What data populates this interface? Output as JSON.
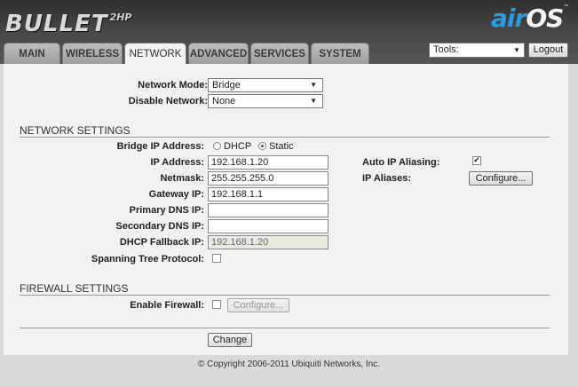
{
  "header": {
    "product_logo": "BULLET",
    "product_model": "2HP",
    "brand_air": "air",
    "brand_os": "OS",
    "brand_tm": "™"
  },
  "tabs": [
    "MAIN",
    "WIRELESS",
    "NETWORK",
    "ADVANCED",
    "SERVICES",
    "SYSTEM"
  ],
  "active_tab": "NETWORK",
  "tools": {
    "selected": "Tools:",
    "logout_label": "Logout"
  },
  "top": {
    "network_mode_label": "Network Mode:",
    "network_mode_value": "Bridge",
    "disable_network_label": "Disable Network:",
    "disable_network_value": "None"
  },
  "network_settings": {
    "title": "NETWORK SETTINGS",
    "bridge_ip_label": "Bridge IP Address:",
    "dhcp_label": "DHCP",
    "static_label": "Static",
    "ip_label": "IP Address:",
    "ip_value": "192.168.1.20",
    "netmask_label": "Netmask:",
    "netmask_value": "255.255.255.0",
    "gateway_label": "Gateway IP:",
    "gateway_value": "192.168.1.1",
    "primary_dns_label": "Primary DNS IP:",
    "primary_dns_value": "",
    "secondary_dns_label": "Secondary DNS IP:",
    "secondary_dns_value": "",
    "dhcp_fallback_label": "DHCP Fallback IP:",
    "dhcp_fallback_value": "192.168.1.20",
    "stp_label": "Spanning Tree Protocol:",
    "auto_ip_aliasing_label": "Auto IP Aliasing:",
    "auto_ip_aliasing_checked": true,
    "ip_aliases_label": "IP Aliases:",
    "configure_label": "Configure..."
  },
  "firewall_settings": {
    "title": "FIREWALL SETTINGS",
    "enable_label": "Enable Firewall:",
    "configure_label": "Configure..."
  },
  "change_label": "Change",
  "footer": "© Copyright 2006-2011 Ubiquiti Networks, Inc."
}
